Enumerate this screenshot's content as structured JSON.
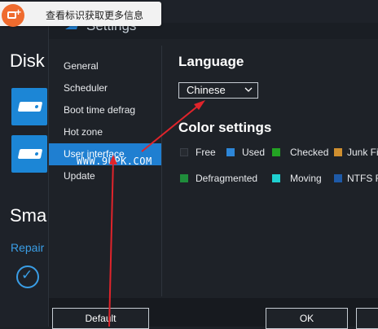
{
  "background_app": {
    "title": "Disk",
    "section2": "Sma",
    "repair_link": "Repair"
  },
  "tooltip": {
    "text": "查看标识获取更多信息",
    "icon": "add-window-icon"
  },
  "dialog": {
    "title": "Settings",
    "sidebar": {
      "items": [
        {
          "label": "General"
        },
        {
          "label": "Scheduler"
        },
        {
          "label": "Boot time defrag"
        },
        {
          "label": "Hot zone"
        },
        {
          "label": "User interface",
          "active": true
        },
        {
          "label": "Update"
        }
      ]
    },
    "language": {
      "heading": "Language",
      "selected": "Chinese"
    },
    "color_settings": {
      "heading": "Color settings",
      "legend": [
        {
          "label": "Free",
          "color": "#262a30"
        },
        {
          "label": "Used",
          "color": "#2d86d8"
        },
        {
          "label": "Checked",
          "color": "#23a323"
        },
        {
          "label": "Junk Fil",
          "color": "#cf8f2f"
        },
        {
          "label": "Defragmented",
          "color": "#1f8d3b"
        },
        {
          "label": "Moving",
          "color": "#1fd0d0"
        },
        {
          "label": "NTFS Fi",
          "color": "#1e5aa8"
        }
      ]
    },
    "buttons": {
      "default": "Default",
      "ok": "OK"
    }
  },
  "watermark": "WWW.9UPK.COM",
  "colors": {
    "accent": "#1f7fd1",
    "arrow": "#e0242b",
    "tooltip_icon": "#ef6b2e"
  }
}
